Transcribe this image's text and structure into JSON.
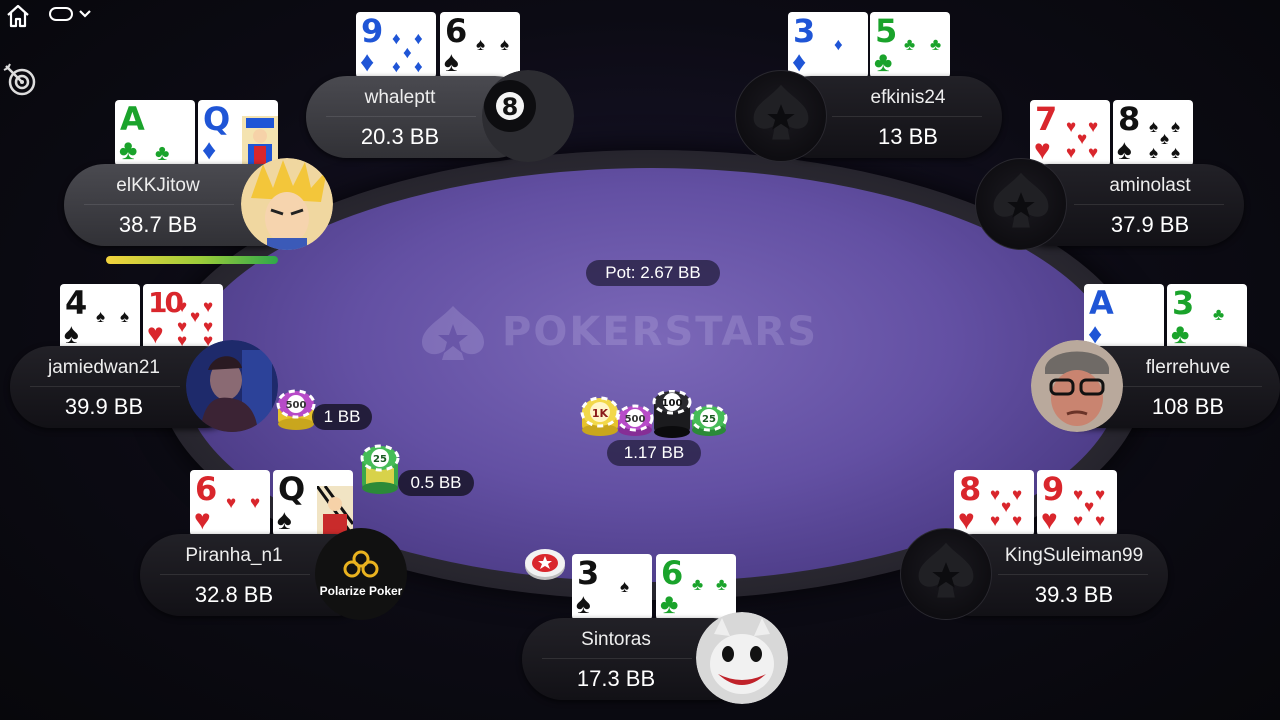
{
  "header": {
    "home_icon": "home-icon",
    "switch_icon": "table-switch-icon",
    "target_icon": "target-icon"
  },
  "table": {
    "logo_text": "POKERSTARS",
    "pot_label": "Pot: 2.67 BB",
    "center_chips_amount": "1.17 BB",
    "felt_color": "#6350a3"
  },
  "bets": {
    "jamiedwan21": {
      "amount": "1 BB",
      "chip_label": "500"
    },
    "piranha": {
      "amount": "0.5 BB",
      "chip_label": "25"
    }
  },
  "center_chip_labels": [
    "1K",
    "500",
    "100",
    "25"
  ],
  "dealer_button": "dealer-button-icon",
  "players": {
    "whaleptt": {
      "name": "whaleptt",
      "stack": "20.3 BB",
      "cards": [
        {
          "rank": "9",
          "suit": "♦"
        },
        {
          "rank": "6",
          "suit": "♠"
        }
      ],
      "avatar": "eight-ball"
    },
    "efkinis24": {
      "name": "efkinis24",
      "stack": "13 BB",
      "cards": [
        {
          "rank": "3",
          "suit": "♦"
        },
        {
          "rank": "5",
          "suit": "♣"
        }
      ],
      "avatar": "pokerstars-default"
    },
    "elKKJitow": {
      "name": "elKKJitow",
      "stack": "38.7 BB",
      "cards": [
        {
          "rank": "A",
          "suit": "♣"
        },
        {
          "rank": "Q",
          "suit": "♦"
        }
      ],
      "avatar": "anime-character",
      "timer_fraction": 1.0
    },
    "aminolast": {
      "name": "aminolast",
      "stack": "37.9 BB",
      "cards": [
        {
          "rank": "7",
          "suit": "♥"
        },
        {
          "rank": "8",
          "suit": "♠"
        }
      ],
      "avatar": "pokerstars-default"
    },
    "jamiedwan21": {
      "name": "jamiedwan21",
      "stack": "39.9 BB",
      "cards": [
        {
          "rank": "4",
          "suit": "♠"
        },
        {
          "rank": "10",
          "suit": "♥"
        }
      ],
      "avatar": "photo"
    },
    "flerrehuve": {
      "name": "flerrehuve",
      "stack": "108 BB",
      "cards": [
        {
          "rank": "A",
          "suit": "♦"
        },
        {
          "rank": "3",
          "suit": "♣"
        }
      ],
      "avatar": "photo"
    },
    "piranha": {
      "name": "Piranha_n1",
      "stack": "32.8 BB",
      "cards": [
        {
          "rank": "6",
          "suit": "♥"
        },
        {
          "rank": "Q",
          "suit": "♠"
        }
      ],
      "avatar": "Polarize Poker"
    },
    "kingsuleiman": {
      "name": "KingSuleiman99",
      "stack": "39.3 BB",
      "cards": [
        {
          "rank": "8",
          "suit": "♥"
        },
        {
          "rank": "9",
          "suit": "♥"
        }
      ],
      "avatar": "pokerstars-default"
    },
    "sintoras": {
      "name": "Sintoras",
      "stack": "17.3 BB",
      "cards": [
        {
          "rank": "3",
          "suit": "♠"
        },
        {
          "rank": "6",
          "suit": "♣"
        }
      ],
      "avatar": "joker-cat"
    }
  }
}
